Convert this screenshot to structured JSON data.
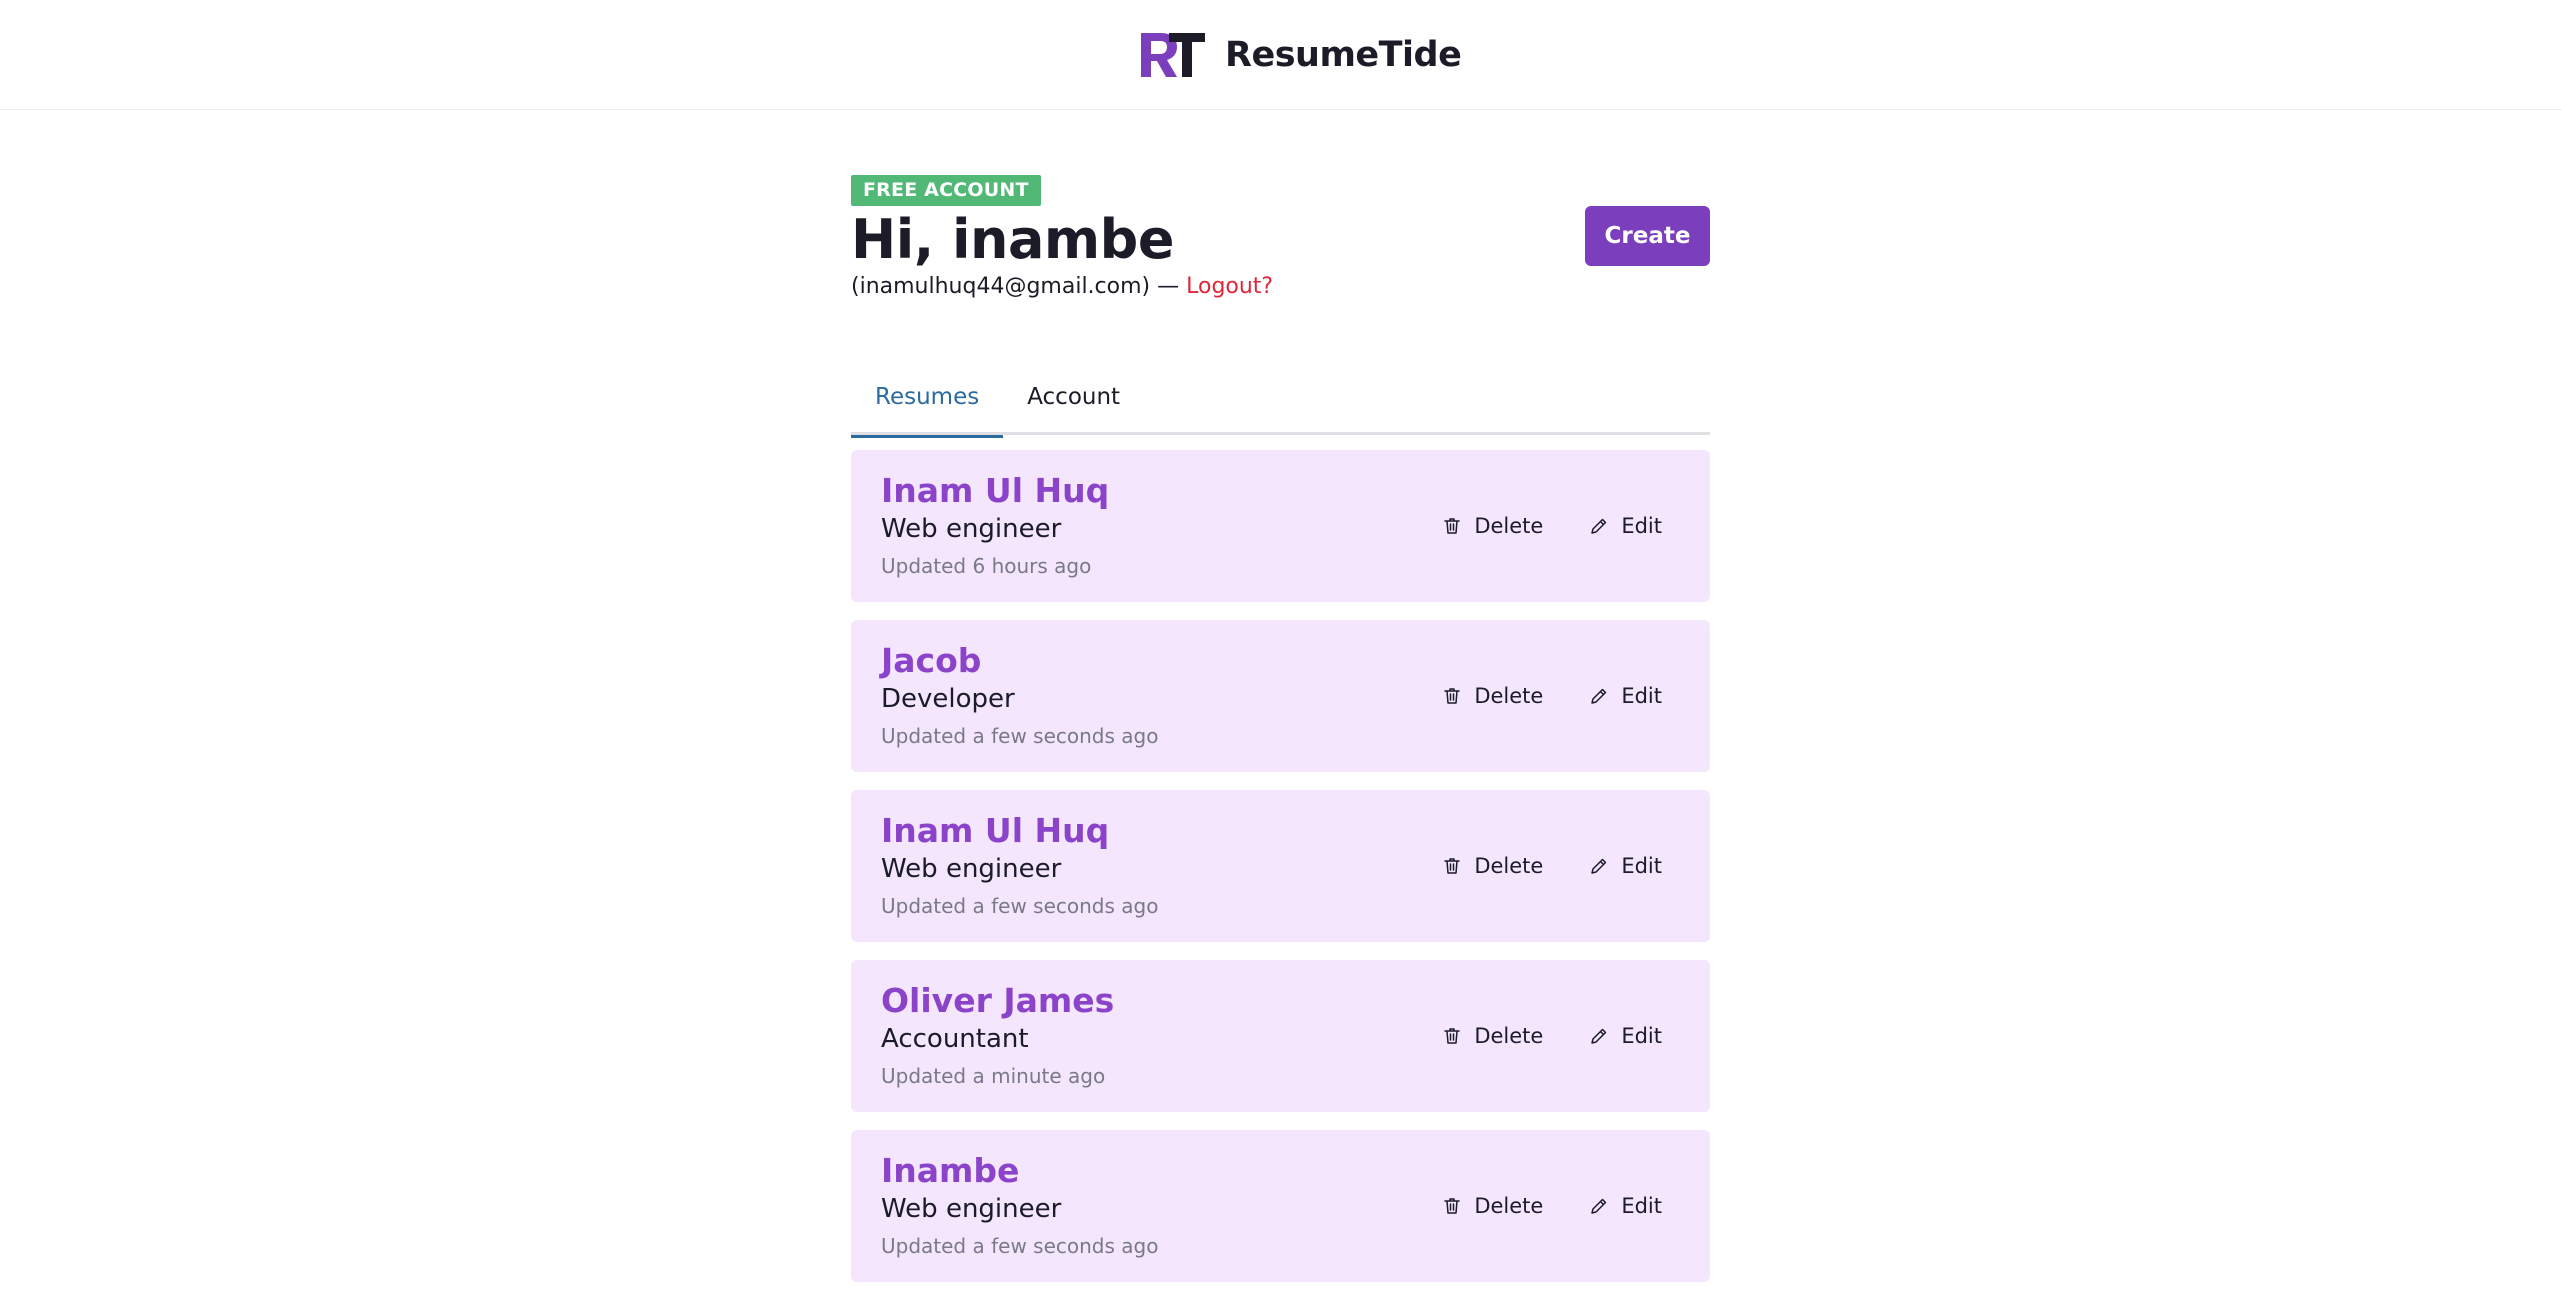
{
  "header": {
    "brand_name": "ResumeTide",
    "colors": {
      "logo_r": "#7b3fbd",
      "logo_t": "#1c1c28"
    }
  },
  "account": {
    "badge": "FREE ACCOUNT",
    "greeting": "Hi, inambe",
    "email_text": "(inamulhuq44@gmail.com) — ",
    "logout_label": "Logout?",
    "create_label": "Create"
  },
  "tabs": [
    {
      "label": "Resumes",
      "active": true
    },
    {
      "label": "Account",
      "active": false
    }
  ],
  "actions": {
    "delete_label": "Delete",
    "edit_label": "Edit"
  },
  "resumes": [
    {
      "name": "Inam Ul Huq",
      "role": "Web engineer",
      "updated": "Updated 6 hours ago"
    },
    {
      "name": "Jacob",
      "role": "Developer",
      "updated": "Updated a few seconds ago"
    },
    {
      "name": "Inam Ul Huq",
      "role": "Web engineer",
      "updated": "Updated a few seconds ago"
    },
    {
      "name": "Oliver James",
      "role": "Accountant",
      "updated": "Updated a minute ago"
    },
    {
      "name": "Inambe",
      "role": "Web engineer",
      "updated": "Updated a few seconds ago"
    }
  ]
}
